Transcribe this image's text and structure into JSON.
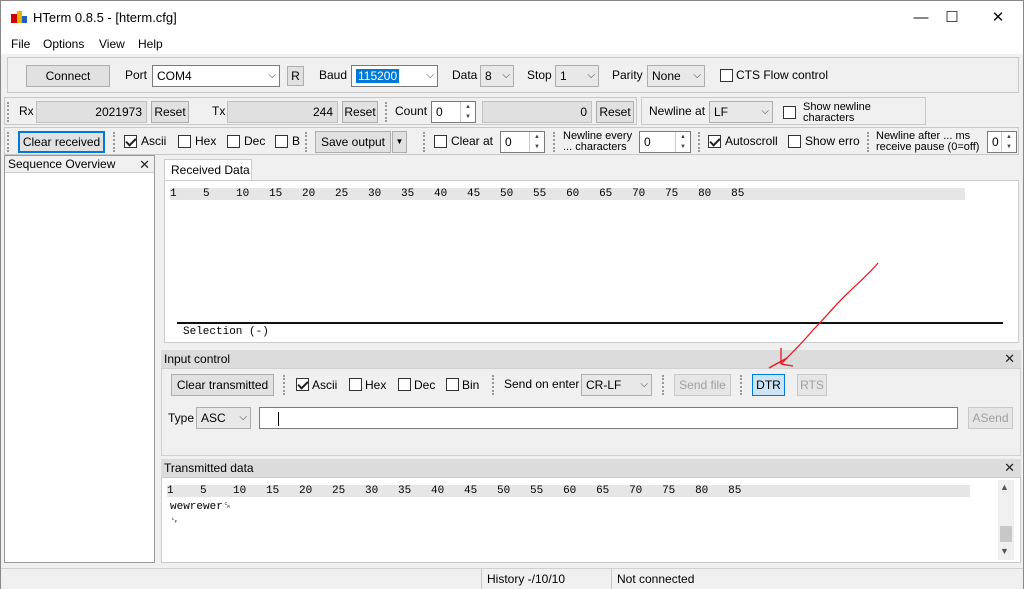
{
  "window": {
    "title": "HTerm 0.8.5 - [hterm.cfg]",
    "minimize": "—",
    "maximize": "☐",
    "close": "✕"
  },
  "menu": [
    {
      "label": "File",
      "key": "F"
    },
    {
      "label": "Options",
      "key": "O"
    },
    {
      "label": "View",
      "key": "V"
    },
    {
      "label": "Help",
      "key": "H"
    }
  ],
  "connection": {
    "connect_label": "Connect",
    "port_label": "Port",
    "port_value": "COM4",
    "r_label": "R",
    "baud_label": "Baud",
    "baud_value": "115200",
    "data_label": "Data",
    "data_value": "8",
    "stop_label": "Stop",
    "stop_value": "1",
    "parity_label": "Parity",
    "parity_value": "None",
    "cts_label": "CTS Flow control",
    "cts_checked": false
  },
  "counters": {
    "rx_label": "Rx",
    "rx_value": "2021973",
    "rx_reset": "Reset",
    "tx_label": "Tx",
    "tx_value": "244",
    "tx_reset": "Reset",
    "count_label": "Count",
    "count_value": "0",
    "count_display": "0",
    "count_reset": "Reset",
    "newline_at_label": "Newline at",
    "newline_at_value": "LF",
    "show_newline_label": "Show newline characters"
  },
  "display": {
    "clear_received": "Clear received",
    "ascii": "Ascii",
    "hex": "Hex",
    "dec": "Dec",
    "bin": "B",
    "save_output": "Save output",
    "save_arrow": "▼",
    "clear_at": "Clear at",
    "clear_at_value": "0",
    "newline_every": "Newline every ... characters",
    "newline_every_value": "0",
    "autoscroll": "Autoscroll",
    "show_errors": "Show errors",
    "newline_after": "Newline after ... ms receive pause (0=off)",
    "newline_after_value": "0"
  },
  "sidebar": {
    "title": "Sequence Overview",
    "close": "✕"
  },
  "received": {
    "tab_label": "Received Data",
    "ruler": "1    5    10   15   20   25   30   35   40   45   50   55   60   65   70   75   80   85",
    "selection": "Selection (-)"
  },
  "input_control": {
    "title": "Input control",
    "close": "✕",
    "clear_transmitted": "Clear transmitted",
    "ascii": "Ascii",
    "hex": "Hex",
    "dec": "Dec",
    "bin": "Bin",
    "send_on_enter_label": "Send on enter",
    "send_on_enter_value": "CR-LF",
    "send_file": "Send file",
    "dtr": "DTR",
    "rts": "RTS",
    "type_label": "Type",
    "type_value": "ASC",
    "input_value": "",
    "asend": "ASend"
  },
  "transmitted": {
    "title": "Transmitted data",
    "close": "✕",
    "ruler": "1    5    10   15   20   25   30   35   40   45   50   55   60   65   70   75   80   85",
    "lines": [
      "wewrewer␍",
      "␊"
    ]
  },
  "status": {
    "history": "History -/10/10",
    "connection": "Not connected"
  },
  "colors": {
    "annotation_arrow": "#e8141c",
    "accent": "#0078d7"
  }
}
